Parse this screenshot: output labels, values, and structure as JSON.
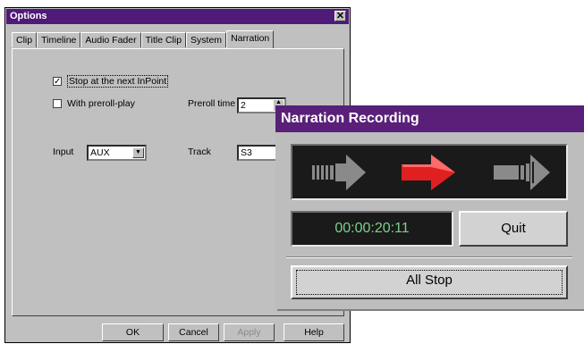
{
  "options": {
    "title": "Options",
    "close_glyph": "✕",
    "tabs": [
      "Clip",
      "Timeline",
      "Audio Fader",
      "Title Clip",
      "System",
      "Narration"
    ],
    "active_tab": "Narration",
    "stop_next_inpoint": {
      "label": "Stop at the next InPoint",
      "checked": true,
      "mark": "✓"
    },
    "with_preroll": {
      "label": "With preroll-play",
      "checked": false
    },
    "preroll_time": {
      "label": "Preroll time",
      "value": "2"
    },
    "input": {
      "label": "Input",
      "value": "AUX"
    },
    "track": {
      "label": "Track",
      "value": "S3"
    },
    "buttons": {
      "ok": "OK",
      "cancel": "Cancel",
      "apply": "Apply",
      "help": "Help"
    }
  },
  "narration": {
    "title": "Narration Recording",
    "timecode": "00:00:20:11",
    "quit_label": "Quit",
    "all_stop_label": "All Stop",
    "arrows": [
      "rewind-arrow-icon",
      "record-arrow-icon",
      "forward-arrow-icon"
    ],
    "colors": {
      "title_bar": "#5a1f78",
      "active_arrow": "#e02020",
      "inactive_arrow": "#8a8a8a",
      "timecode": "#7ed08a"
    }
  }
}
